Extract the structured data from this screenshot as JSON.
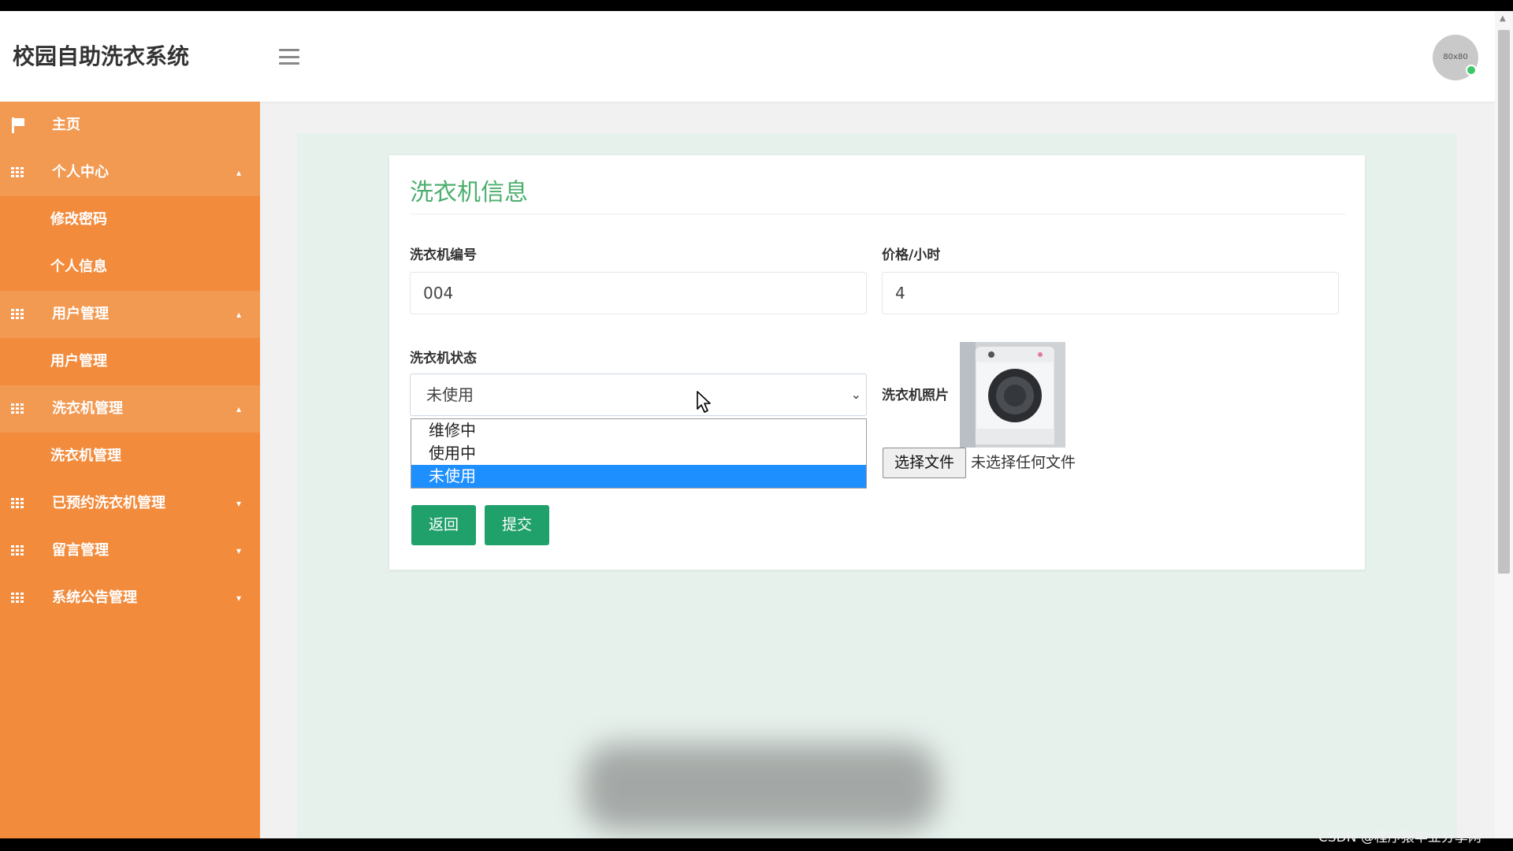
{
  "header": {
    "brand": "校园自助洗衣系统",
    "avatar_text": "80x80"
  },
  "sidebar": {
    "items": [
      {
        "label": "主页",
        "icon": "flag-icon"
      },
      {
        "label": "个人中心",
        "icon": "grid-icon",
        "expanded": true,
        "children": [
          "修改密码",
          "个人信息"
        ]
      },
      {
        "label": "用户管理",
        "icon": "grid-icon",
        "expanded": true,
        "children": [
          "用户管理"
        ]
      },
      {
        "label": "洗衣机管理",
        "icon": "grid-icon",
        "expanded": true,
        "children": [
          "洗衣机管理"
        ]
      },
      {
        "label": "已预约洗衣机管理",
        "icon": "grid-icon",
        "expanded": false
      },
      {
        "label": "留言管理",
        "icon": "grid-icon",
        "expanded": false
      },
      {
        "label": "系统公告管理",
        "icon": "grid-icon",
        "expanded": false
      }
    ]
  },
  "form": {
    "title": "洗衣机信息",
    "machine_no": {
      "label": "洗衣机编号",
      "value": "004"
    },
    "price": {
      "label": "价格/小时",
      "value": "4"
    },
    "status": {
      "label": "洗衣机状态",
      "value": "未使用",
      "options": [
        "维修中",
        "使用中",
        "未使用"
      ],
      "selected_index": 2
    },
    "photo": {
      "label": "洗衣机照片"
    },
    "file": {
      "button": "选择文件",
      "status": "未选择任何文件"
    },
    "buttons": {
      "back": "返回",
      "submit": "提交"
    }
  },
  "watermark": "CSDN @程序猿毕业分享网",
  "colors": {
    "sidebar": "#f28b3c",
    "accent_green": "#20a06a",
    "title_green": "#4caf6e",
    "option_selected": "#1e8fff"
  }
}
